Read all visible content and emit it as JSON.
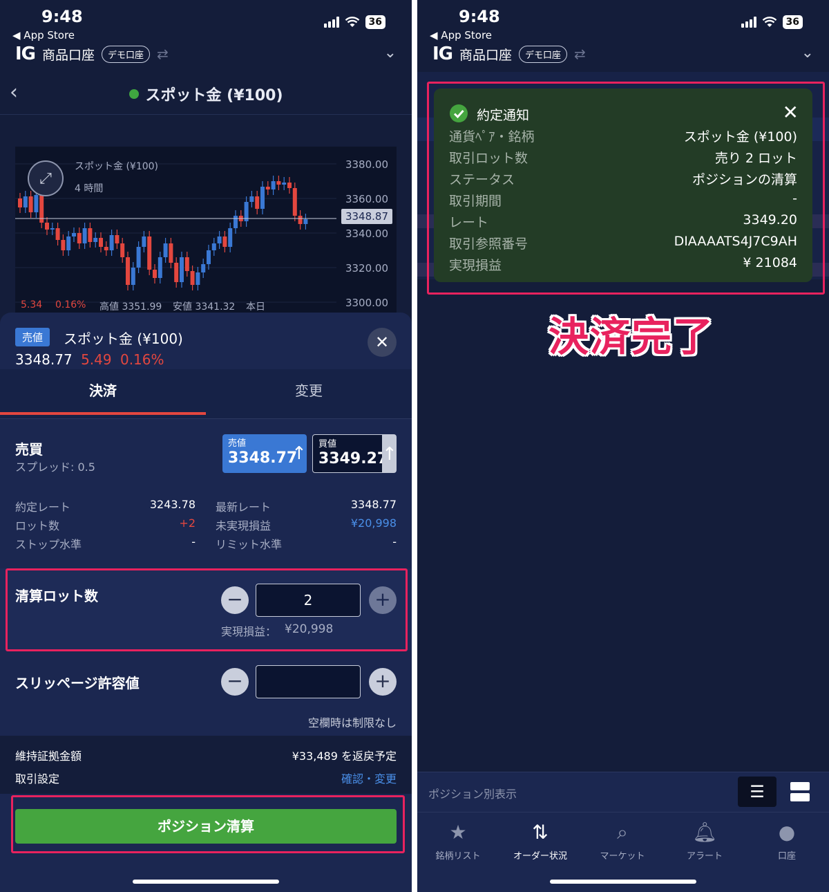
{
  "status": {
    "time": "9:48",
    "back_app": "◀ App Store",
    "battery": "36"
  },
  "account": {
    "logo": "IG",
    "name": "商品口座",
    "badge": "デモ口座"
  },
  "left": {
    "nav_title": "スポット金 (¥100)",
    "chart": {
      "name": "スポット金 (¥100)",
      "interval": "4 時間",
      "current_price": "3348.87",
      "y_ticks": [
        "3380.00",
        "3360.00",
        "3340.00",
        "3320.00",
        "3300.00"
      ],
      "bottom_change": "5.34",
      "bottom_pct": "0.16%",
      "high": "高値 3351.99",
      "low": "安値 3341.32",
      "day": "本日"
    },
    "sheet": {
      "badge": "売値",
      "name": "スポット金 (¥100)",
      "price": "3348.77",
      "change": "5.49",
      "pct": "0.16%",
      "tab_settle": "決済",
      "tab_change": "変更",
      "trade_label": "売買",
      "spread": "スプレッド: 0.5",
      "sell_box": {
        "label": "売値",
        "value": "3348.77"
      },
      "buy_box": {
        "label": "買値",
        "value": "3349.27"
      },
      "details": [
        {
          "k": "約定レート",
          "v": "3243.78"
        },
        {
          "k": "ロット数",
          "v": "+2"
        },
        {
          "k": "ストップ水準",
          "v": "-"
        },
        {
          "k": "最新レート",
          "v": "3348.77"
        },
        {
          "k": "未実現損益",
          "v": "¥20,998"
        },
        {
          "k": "リミット水準",
          "v": "-"
        }
      ],
      "close_lots_label": "清算ロット数",
      "close_lots_value": "2",
      "realized_label": "実現損益：",
      "realized_value": "¥20,998",
      "slippage_label": "スリッページ許容値",
      "slippage_value": "",
      "slippage_note": "空欄時は制限なし",
      "margin_label": "維持証拠金額",
      "margin_value": "¥33,489 を返戻予定",
      "settings_label": "取引設定",
      "settings_link": "確認・変更",
      "submit": "ポジション清算"
    }
  },
  "right": {
    "notification": {
      "title": "約定通知",
      "rows": [
        {
          "k": "通貨ﾍﾟｱ・銘柄",
          "v": "スポット金 (¥100)"
        },
        {
          "k": "取引ロット数",
          "v": "売り 2 ロット"
        },
        {
          "k": "ステータス",
          "v": "ポジションの清算"
        },
        {
          "k": "取引期間",
          "v": "-"
        },
        {
          "k": "レート",
          "v": "3349.20"
        },
        {
          "k": "取引参照番号",
          "v": "DIAAAATS4J7C9AH"
        },
        {
          "k": "実現損益",
          "v": "¥ 21084"
        }
      ]
    },
    "annotation": "決済完了",
    "position_view": "ポジション別表示",
    "tabbar": [
      {
        "label": "銘柄リスト",
        "icon": "star-icon"
      },
      {
        "label": "オーダー状況",
        "icon": "order-arrows-icon"
      },
      {
        "label": "マーケット",
        "icon": "search-icon"
      },
      {
        "label": "アラート",
        "icon": "bell-icon"
      },
      {
        "label": "口座",
        "icon": "account-icon"
      }
    ]
  },
  "colors": {
    "highlight": "#e8225e",
    "green": "#45a53f",
    "red": "#e3473f",
    "blue": "#4a8fe8",
    "bg": "#141d3a"
  }
}
